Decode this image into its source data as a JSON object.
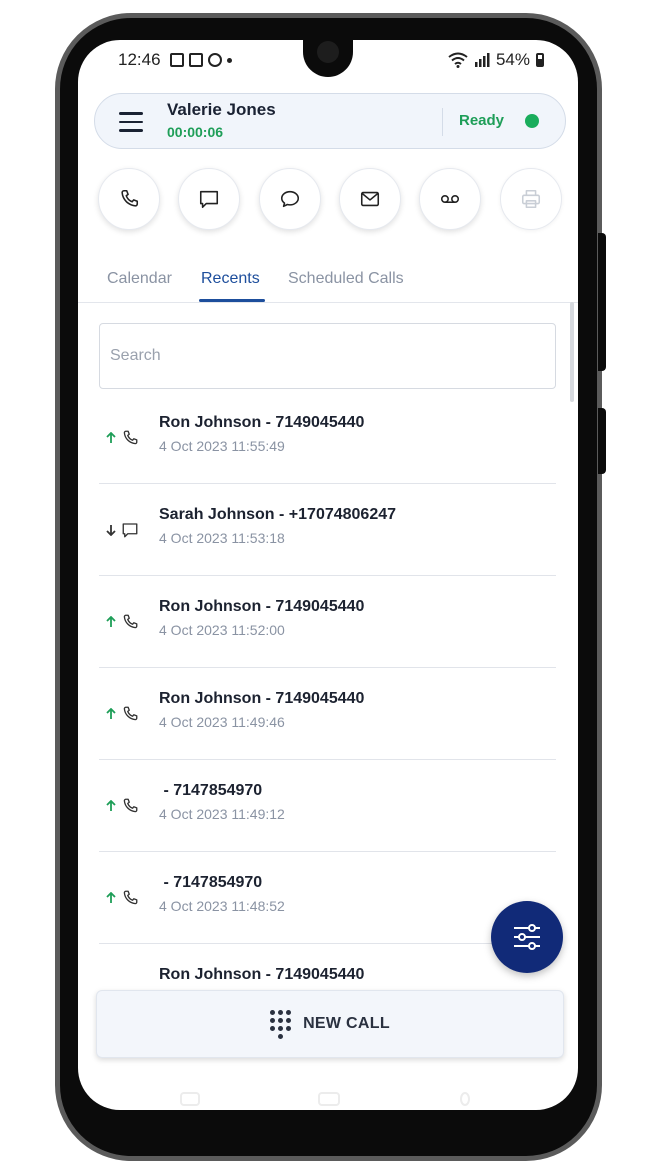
{
  "status_bar": {
    "time": "12:46",
    "battery": "54%"
  },
  "agent": {
    "name": "Valerie Jones",
    "timer": "00:00:06",
    "status": "Ready",
    "status_color": "#1aad5c"
  },
  "actions": [
    {
      "id": "call",
      "icon": "phone-icon",
      "enabled": true
    },
    {
      "id": "sms",
      "icon": "message-square-icon",
      "enabled": true
    },
    {
      "id": "chat",
      "icon": "chat-bubble-icon",
      "enabled": true
    },
    {
      "id": "email",
      "icon": "mail-icon",
      "enabled": true
    },
    {
      "id": "voicemail",
      "icon": "voicemail-icon",
      "enabled": true
    },
    {
      "id": "print",
      "icon": "printer-icon",
      "enabled": false
    }
  ],
  "tabs": [
    {
      "label": "Calendar",
      "active": false
    },
    {
      "label": "Recents",
      "active": true
    },
    {
      "label": "Scheduled Calls",
      "active": false
    }
  ],
  "search": {
    "placeholder": "Search",
    "value": ""
  },
  "recents": [
    {
      "direction": "outbound",
      "kind": "call",
      "title": "Ron Johnson - 7149045440",
      "datetime": "4 Oct 2023 11:55:49"
    },
    {
      "direction": "inbound",
      "kind": "sms",
      "title": "Sarah Johnson - +17074806247",
      "datetime": "4 Oct 2023 11:53:18"
    },
    {
      "direction": "outbound",
      "kind": "call",
      "title": "Ron Johnson - 7149045440",
      "datetime": "4 Oct 2023 11:52:00"
    },
    {
      "direction": "outbound",
      "kind": "call",
      "title": "Ron Johnson - 7149045440",
      "datetime": "4 Oct 2023 11:49:46"
    },
    {
      "direction": "outbound",
      "kind": "call",
      "title": " - 7147854970",
      "datetime": "4 Oct 2023 11:49:12"
    },
    {
      "direction": "outbound",
      "kind": "call",
      "title": " - 7147854970",
      "datetime": "4 Oct 2023 11:48:52"
    },
    {
      "direction": "outbound",
      "kind": "call",
      "title": "Ron Johnson - 7149045440",
      "datetime": ""
    }
  ],
  "filter_button": {
    "icon": "sliders-icon"
  },
  "new_call": {
    "label": "NEW CALL",
    "icon": "dialpad-icon"
  },
  "colors": {
    "accent": "#1d4e9c",
    "fab": "#112a78",
    "ready": "#1e9e58",
    "outbound_arrow": "#1e9e58"
  }
}
